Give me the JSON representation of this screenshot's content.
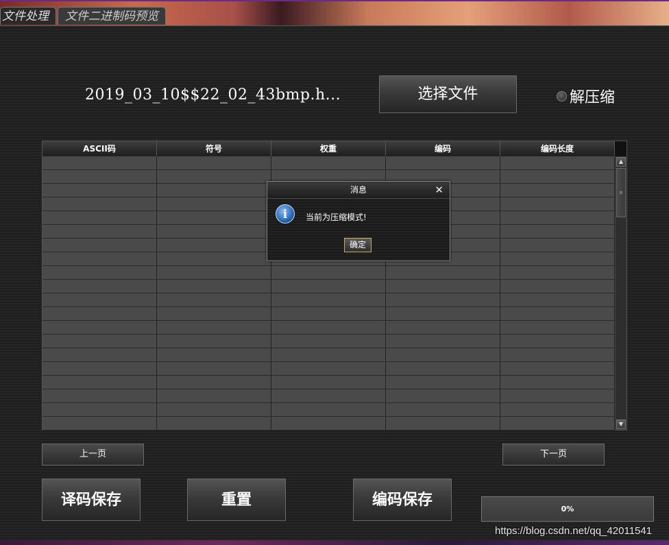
{
  "tabs": [
    {
      "label": "文件处理",
      "active": true
    },
    {
      "label": "文件二进制码预览",
      "active": false
    }
  ],
  "file": {
    "name": "2019_03_10$$22_02_43bmp.h...",
    "select_button": "选择文件"
  },
  "mode_radio": {
    "label": "解压缩",
    "checked": false
  },
  "table": {
    "columns": [
      "ASCII码",
      "符号",
      "权重",
      "编码",
      "编码长度"
    ],
    "visible_row_count": 20,
    "rows": []
  },
  "dialog": {
    "title": "消息",
    "close": "✕",
    "icon": "info-icon",
    "icon_glyph": "i",
    "message": "当前为压缩模式!",
    "ok_label": "确定"
  },
  "pagination": {
    "prev_label": "上一页",
    "next_label": "下一页"
  },
  "actions": {
    "decode_save_label": "译码保存",
    "reset_label": "重置",
    "encode_save_label": "编码保存"
  },
  "progress": {
    "value": 0,
    "text": "0%"
  },
  "watermark": "https://blog.csdn.net/qq_42011541",
  "colors": {
    "panel_bg": "#1e1e1e",
    "table_cell": "#4a4a4a",
    "progress_fill": "#1a8a2a",
    "dialog_icon": "#1a5ab0"
  }
}
